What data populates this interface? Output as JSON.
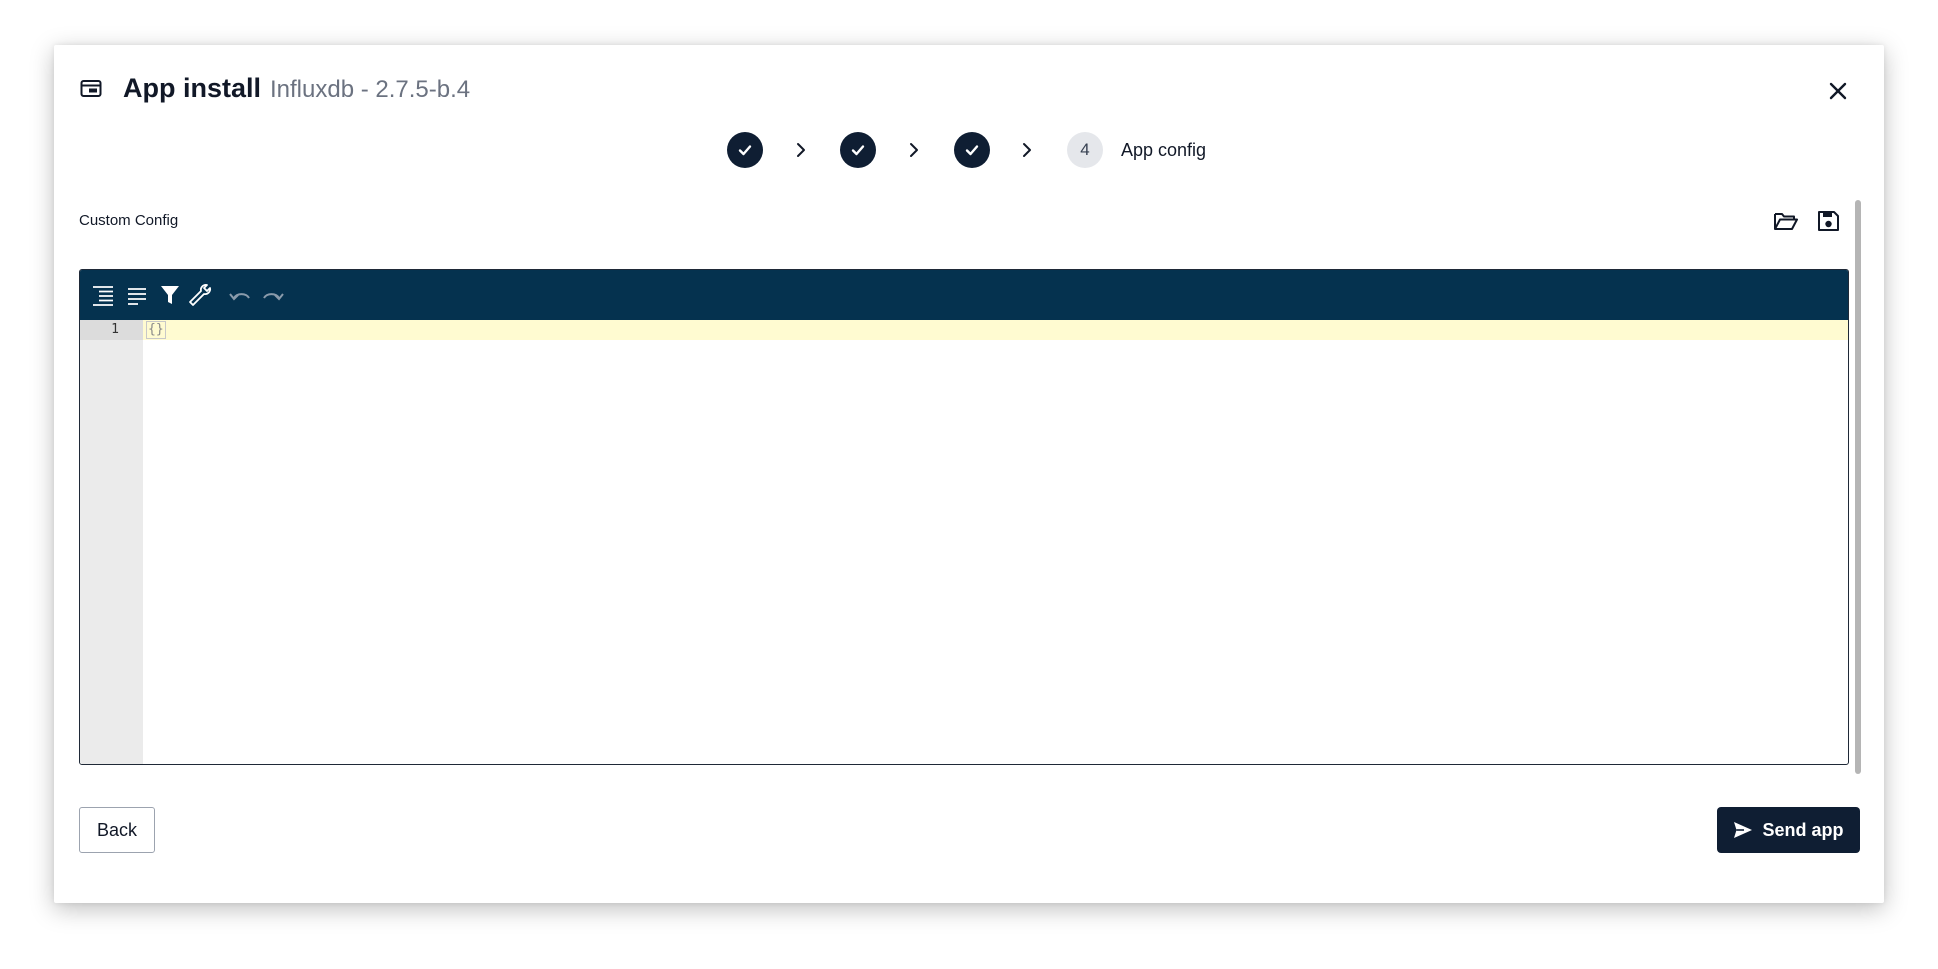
{
  "dialog": {
    "title": "App install",
    "subtitle": "Influxdb - 2.7.5-b.4"
  },
  "stepper": {
    "steps": [
      {
        "state": "completed"
      },
      {
        "state": "completed"
      },
      {
        "state": "completed"
      },
      {
        "state": "current",
        "number": "4",
        "label": "App config"
      }
    ]
  },
  "config": {
    "label": "Custom Config",
    "open_icon": "folder-open-icon",
    "save_icon": "floppy-disk-icon"
  },
  "editor": {
    "toolbar": [
      "format-icon",
      "compact-icon",
      "filter-icon",
      "repair-icon",
      "undo-icon",
      "redo-icon"
    ],
    "lines": [
      {
        "number": "1",
        "text": "{}"
      }
    ]
  },
  "footer": {
    "back_label": "Back",
    "send_label": "Send app"
  },
  "colors": {
    "primary": "#0f1e33",
    "toolbar": "#05324f",
    "active_line": "#fffbd1"
  }
}
